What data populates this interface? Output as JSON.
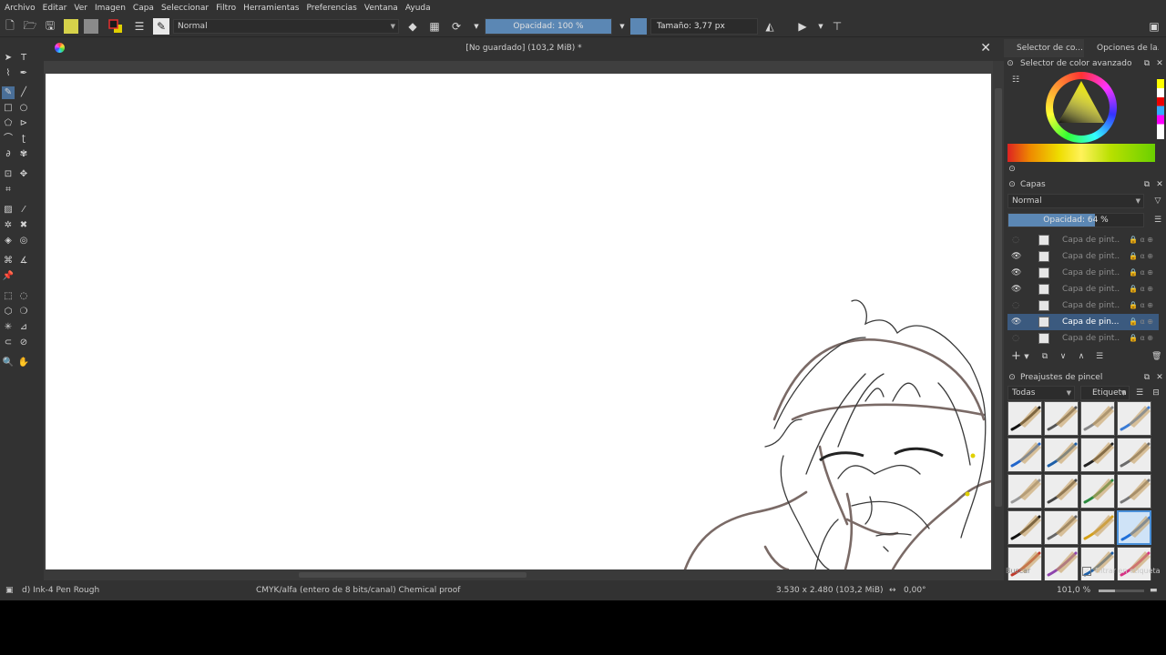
{
  "menu": [
    "Archivo",
    "Editar",
    "Ver",
    "Imagen",
    "Capa",
    "Seleccionar",
    "Filtro",
    "Herramientas",
    "Preferencias",
    "Ventana",
    "Ayuda"
  ],
  "toolbar": {
    "blend_mode": "Normal",
    "opacity_label": "Opacidad: 100 %",
    "size_label": "Tamaño: 3,77 px"
  },
  "document": {
    "title": "[No guardado]  (103,2 MiB) *"
  },
  "dock": {
    "tab1": "Selector de co...",
    "tab2": "Opciones de la...",
    "color_header": "Selector de color avanzado",
    "layers_header": "Capas",
    "layers_blend": "Normal",
    "layers_opacity": "Opacidad: 64 %",
    "layers_opacity_value": 0.64,
    "layers": [
      {
        "name": "Capa de pint...",
        "visible": false,
        "selected": false
      },
      {
        "name": "Capa de pint...",
        "visible": true,
        "selected": false
      },
      {
        "name": "Capa de pint...",
        "visible": true,
        "selected": false
      },
      {
        "name": "Capa de pint...",
        "visible": true,
        "selected": false
      },
      {
        "name": "Capa de pint...",
        "visible": false,
        "selected": false
      },
      {
        "name": "Capa de pin...",
        "visible": true,
        "selected": true
      },
      {
        "name": "Capa de pint...",
        "visible": false,
        "selected": false
      }
    ],
    "brush_header": "Preajustes de pincel",
    "brush_filter": "Todas",
    "brush_tag": "Etiqueta",
    "search_placeholder": "Buscar",
    "filter_tag": "Filtrar en etiqueta"
  },
  "status": {
    "brush": "d) Ink-4 Pen Rough",
    "colorspace": "CMYK/alfa (entero de 8 bits/canal)  Chemical proof",
    "dimensions": "3.530 x 2.480 (103,2 MiB)",
    "rotation": "0,00°",
    "zoom": "101,0 %"
  },
  "colors": {
    "accent": "#5b87b4",
    "selection": "#3b5a7f",
    "panel": "#323232"
  }
}
